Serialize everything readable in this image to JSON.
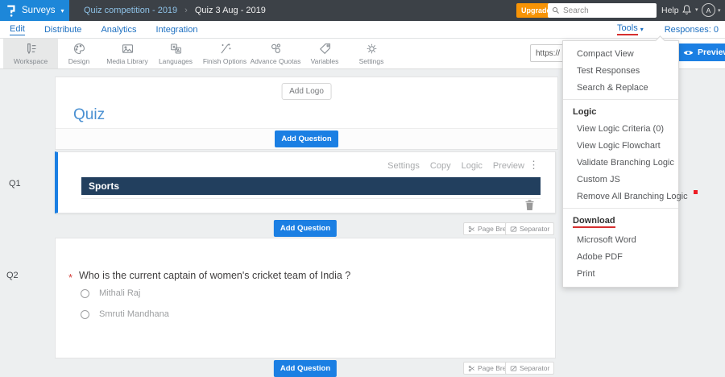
{
  "topbar": {
    "product_label": "Surveys",
    "breadcrumb": [
      "Quiz competition - 2019",
      "Quiz 3 Aug - 2019"
    ],
    "upgrade_label": "Upgrade Now",
    "search_placeholder": "Search",
    "help_label": "Help",
    "avatar_initial": "A"
  },
  "nav": {
    "items": [
      "Edit",
      "Distribute",
      "Analytics",
      "Integration"
    ],
    "tools_label": "Tools",
    "responses_label": "Responses: 0"
  },
  "toolbar": {
    "items": [
      {
        "label": "Workspace"
      },
      {
        "label": "Design"
      },
      {
        "label": "Media Library"
      },
      {
        "label": "Languages"
      },
      {
        "label": "Finish Options"
      },
      {
        "label": "Advance Quotas"
      },
      {
        "label": "Variables"
      },
      {
        "label": "Settings"
      }
    ],
    "url_value": "https://",
    "preview_label": "Preview"
  },
  "tools_menu": {
    "groups": [
      {
        "items": [
          "Compact View",
          "Test Responses",
          "Search & Replace"
        ]
      },
      {
        "header": "Logic",
        "items": [
          "View Logic Criteria (0)",
          "View Logic Flowchart",
          "Validate Branching Logic",
          "Custom JS",
          "Remove All Branching Logic"
        ]
      },
      {
        "header": "Download",
        "items": [
          "Microsoft Word",
          "Adobe PDF",
          "Print"
        ]
      }
    ]
  },
  "builder": {
    "add_logo_label": "Add Logo",
    "survey_title": "Quiz",
    "add_question_label": "Add Question",
    "page_break_label": "Page Break",
    "separator_label": "Separator",
    "q1": {
      "label": "Q1",
      "action_links": [
        "Settings",
        "Copy",
        "Logic",
        "Preview"
      ],
      "section_title": "Sports"
    },
    "q2": {
      "label": "Q2",
      "required_marker": "*",
      "question_text": "Who is the current captain of women's cricket team of India ?",
      "options": [
        "Mithali Raj",
        "Smruti Mandhana"
      ]
    }
  },
  "colors": {
    "brand_blue": "#1d87d9",
    "topbar_dark": "#3c4147",
    "accent_blue": "#1b7fe3",
    "navy_header": "#223f5e",
    "upgrade_orange": "#f89406",
    "annotation_red": "#d62f2f"
  }
}
